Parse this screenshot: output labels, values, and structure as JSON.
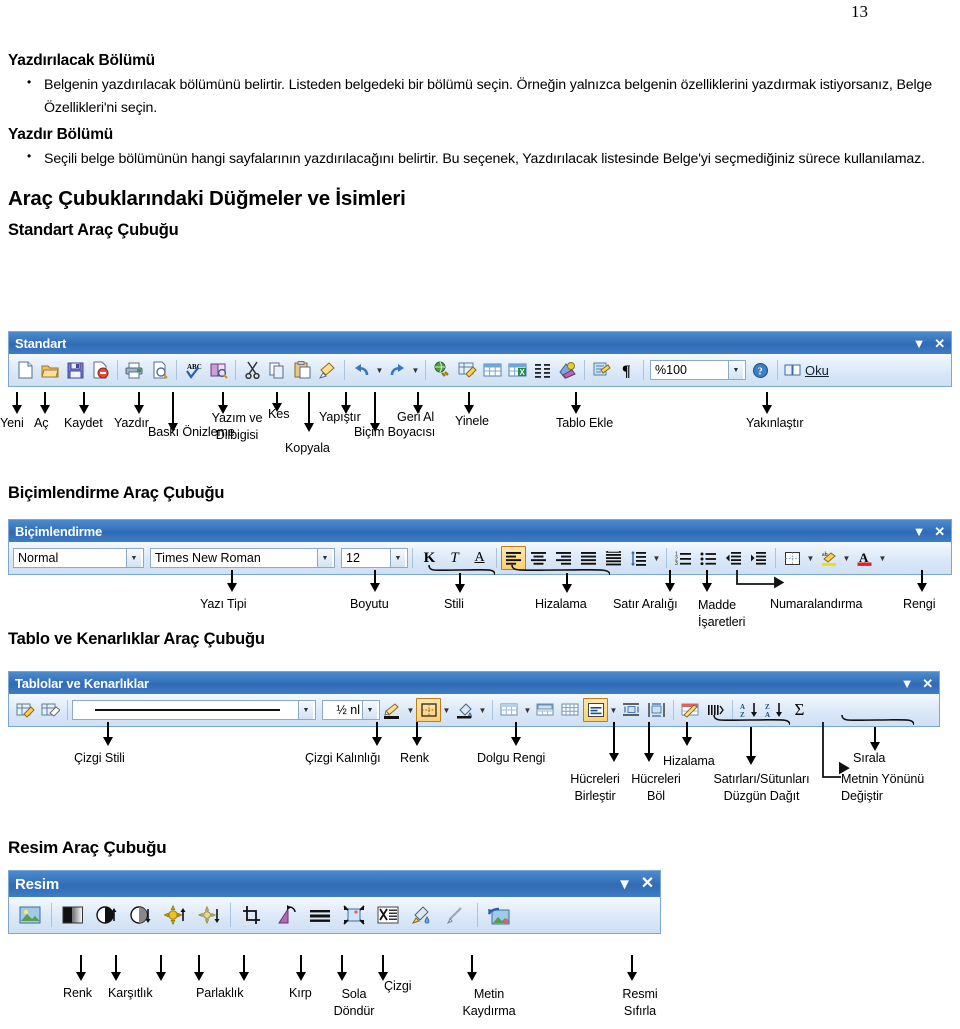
{
  "page_number": "13",
  "sections": {
    "yazdirilacak_heading": "Yazdırılacak Bölümü",
    "yazdirilacak_bullet": "Belgenin yazdırılacak bölümünü belirtir. Listeden belgedeki bir bölümü seçin. Örneğin yalnızca belgenin özelliklerini yazdırmak istiyorsanız, Belge Özellikleri'ni seçin.",
    "yazdir_heading": "Yazdır Bölümü",
    "yazdir_bullet": "Seçili belge bölümünün hangi sayfalarının yazdırılacağını belirtir. Bu seçenek, Yazdırılacak listesinde Belge'yi seçmediğiniz sürece kullanılamaz.",
    "main_heading": "Araç Çubuklarındaki Düğmeler ve İsimleri",
    "standart_heading": "Standart Araç Çubuğu",
    "bicimlendirme_heading": "Biçimlendirme Araç Çubuğu",
    "tablo_heading": "Tablo ve Kenarlıklar Araç Çubuğu",
    "resim_heading": "Resim Araç Çubuğu"
  },
  "colors": {
    "title_bar_blue": "#2f6cb5",
    "toolbar_border": "#7aa7d4",
    "toolbar_face": "#d9e7f7",
    "pressed_orange": "#fccf72"
  },
  "standart_toolbar": {
    "title": "Standart",
    "window_collapse": "▼",
    "window_close": "✕",
    "zoom_value": "%100",
    "read_label": "Oku",
    "buttons": [
      "new-document-icon",
      "open-folder-icon",
      "save-disk-icon",
      "mail-recipient-icon",
      "print-icon",
      "print-preview-icon",
      "spelling-grammar-icon",
      "research-icon",
      "cut-scissors-icon",
      "copy-icon",
      "paste-icon",
      "format-painter-icon",
      "undo-icon",
      "redo-icon",
      "insert-hyperlink-icon",
      "tables-borders-icon",
      "insert-table-icon",
      "insert-excel-sheet-icon",
      "columns-icon",
      "drawing-icon",
      "document-map-icon",
      "show-formatting-marks-icon",
      "zoom-combo",
      "help-icon",
      "reading-layout-icon"
    ],
    "labels": [
      "Yeni",
      "Aç",
      "Kaydet",
      "Yazdır",
      "Baskı Önizleme",
      "Yazım ve Dilbigisi",
      "Kes",
      "Kopyala",
      "Yapıştır",
      "Biçim Boyacısı",
      "Geri Al",
      "Yinele",
      "Tablo Ekle",
      "Yakınlaştır"
    ]
  },
  "bicimlendirme_toolbar": {
    "title": "Biçimlendirme",
    "window_collapse": "▼",
    "window_close": "✕",
    "style_value": "Normal",
    "font_value": "Times New Roman",
    "size_value": "12",
    "bold_glyph": "K",
    "italic_glyph": "T",
    "underline_glyph": "A",
    "labels": [
      "Yazı Tipi",
      "Boyutu",
      "Stili",
      "Hizalama",
      "Satır Aralığı",
      "Madde İşaretleri",
      "Numaralandırma",
      "Rengi"
    ]
  },
  "tablo_toolbar": {
    "title": "Tablolar ve Kenarlıklar",
    "window_collapse": "▼",
    "window_close": "✕",
    "line_weight_value": "½ nl",
    "sum_glyph": "Σ",
    "sort_az_glyph": "A Z",
    "sort_za_glyph": "Z A",
    "labels": [
      "Çizgi Stili",
      "Çizgi Kalınlığı",
      "Renk",
      "Dolgu Rengi",
      "Hücreleri Birleştir",
      "Hücreleri Böl",
      "Hizalama",
      "Satırları/Sütunları Düzgün Dağıt",
      "Sırala",
      "Metnin Yönünü Değiştir"
    ]
  },
  "resim_toolbar": {
    "title": "Resim",
    "window_collapse": "▼",
    "window_close": "✕",
    "labels": [
      "Renk",
      "Karşıtlık",
      "Parlaklık",
      "Kırp",
      "Sola Döndür",
      "Çizgi",
      "Metin Kaydırma",
      "Resmi Sıfırla"
    ]
  }
}
